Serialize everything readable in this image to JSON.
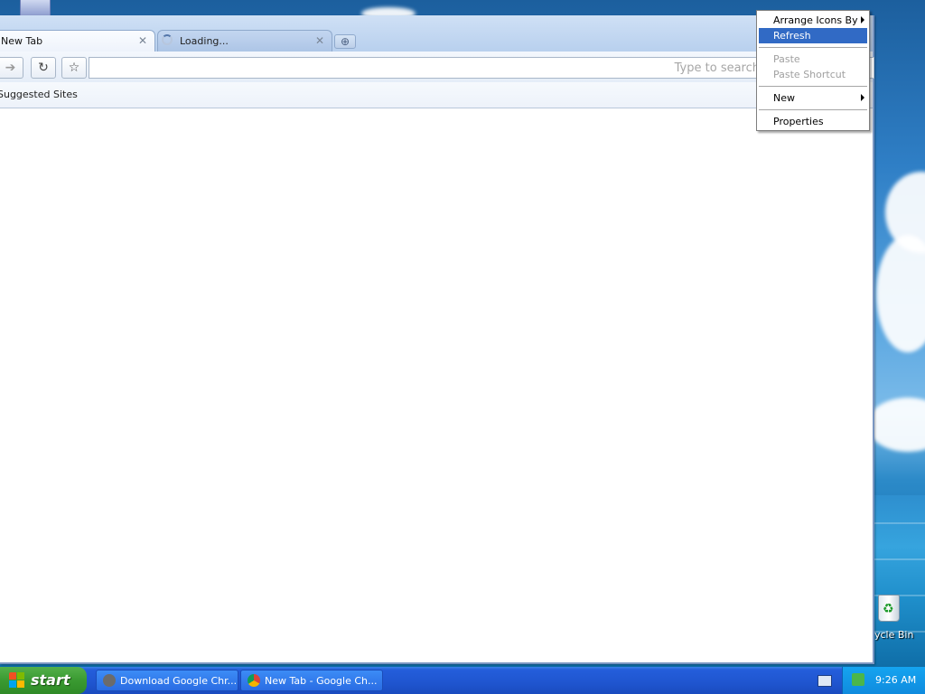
{
  "browser": {
    "tabs": [
      {
        "title": "New Tab",
        "state": "active"
      },
      {
        "title": "Loading...",
        "state": "loading"
      }
    ],
    "omnibox_placeholder": "Type to search",
    "bookmarks_bar": {
      "label": "Suggested Sites"
    }
  },
  "context_menu": {
    "items": [
      {
        "label": "Arrange Icons By",
        "submenu": true,
        "disabled": false
      },
      {
        "label": "Refresh",
        "selected": true,
        "disabled": false
      },
      {
        "label": "Paste",
        "disabled": true
      },
      {
        "label": "Paste Shortcut",
        "disabled": true
      },
      {
        "label": "New",
        "submenu": true,
        "disabled": false
      },
      {
        "label": "Properties",
        "disabled": false
      }
    ]
  },
  "desktop": {
    "recycle_bin_label": "ycle Bin"
  },
  "taskbar": {
    "start_label": "start",
    "tasks": [
      {
        "label": "Download Google Chr...",
        "icon": "chrome-download-icon"
      },
      {
        "label": "New Tab - Google Ch...",
        "icon": "chrome-icon"
      }
    ],
    "clock": "9:26 AM"
  },
  "colors": {
    "menu_highlight": "#316ac5",
    "taskbar_blue": "#245edb",
    "start_green": "#3a9a31"
  }
}
